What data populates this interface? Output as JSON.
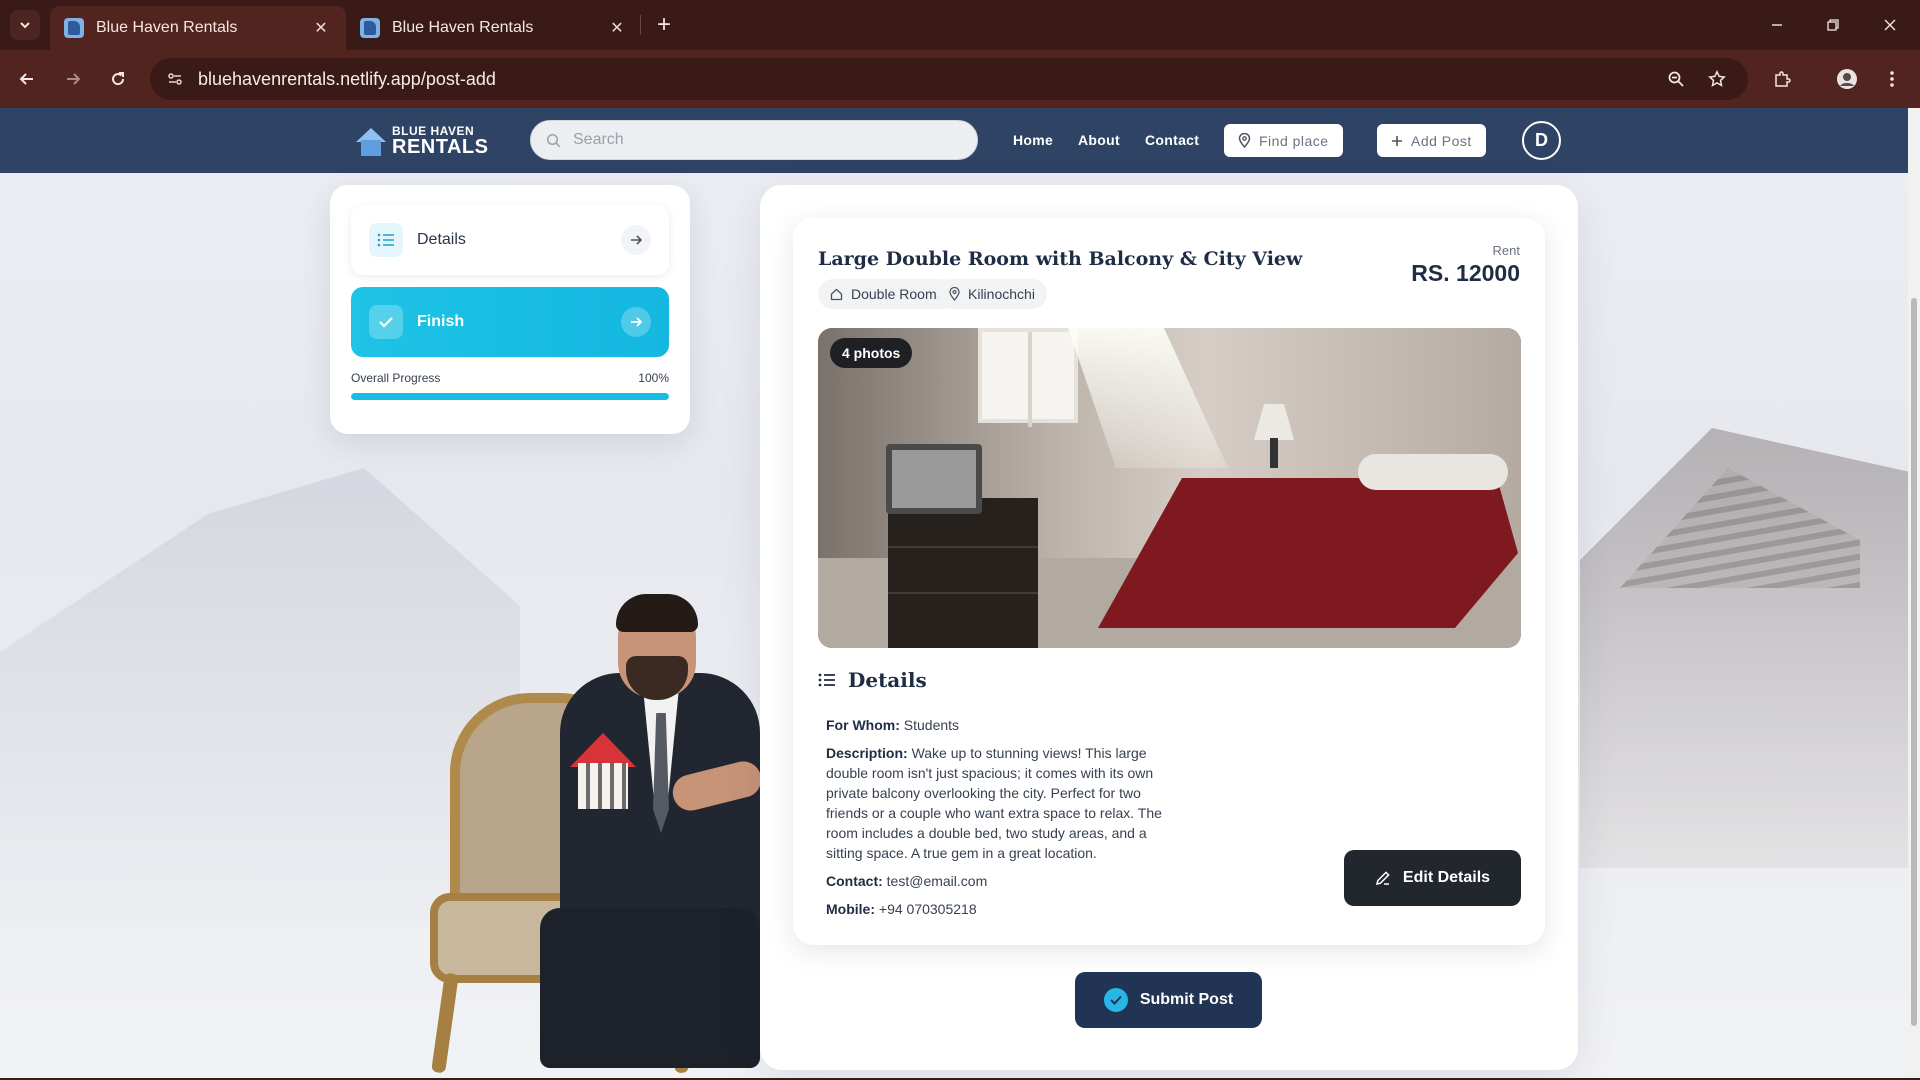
{
  "browser": {
    "tabs": [
      {
        "title": "Blue Haven Rentals",
        "active": true
      },
      {
        "title": "Blue Haven Rentals",
        "active": false
      }
    ],
    "url": "bluehavenrentals.netlify.app/post-add"
  },
  "header": {
    "logo_line1": "BLUE HAVEN",
    "logo_line2": "RENTALS",
    "search_placeholder": "Search",
    "nav": [
      "Home",
      "About",
      "Contact"
    ],
    "find_place_label": "Find place",
    "add_post_label": "Add Post",
    "avatar_initial": "D"
  },
  "stepper": {
    "steps": [
      {
        "label": "Details",
        "icon": "list-icon"
      },
      {
        "label": "Finish",
        "icon": "check-icon"
      }
    ],
    "progress_label": "Overall Progress",
    "progress_text": "100%",
    "progress_value": 1.0
  },
  "listing": {
    "title": "Large Double Room with Balcony & City View",
    "category": "Double Rooms",
    "location": "Kilinochchi",
    "rent_label": "Rent",
    "price": "RS. 12000",
    "photo_badge": "4 photos",
    "details_heading": "Details",
    "for_whom_label": "For Whom:",
    "for_whom": "Students",
    "description_label": "Description:",
    "description": "Wake up to stunning views! This large double room isn't just spacious; it comes with its own private balcony overlooking the city. Perfect for two friends or a couple who want extra space to relax. The room includes a double bed, two study areas, and a sitting space. A true gem in a great location.",
    "contact_label": "Contact:",
    "contact": "test@email.com",
    "mobile_label": "Mobile:",
    "mobile": "+94 070305218",
    "edit_label": "Edit Details"
  },
  "submit_label": "Submit Post",
  "colors": {
    "header_bg": "#2f4365",
    "accent": "#17bde3",
    "dark_button": "#22272d",
    "submit_button": "#213453"
  }
}
